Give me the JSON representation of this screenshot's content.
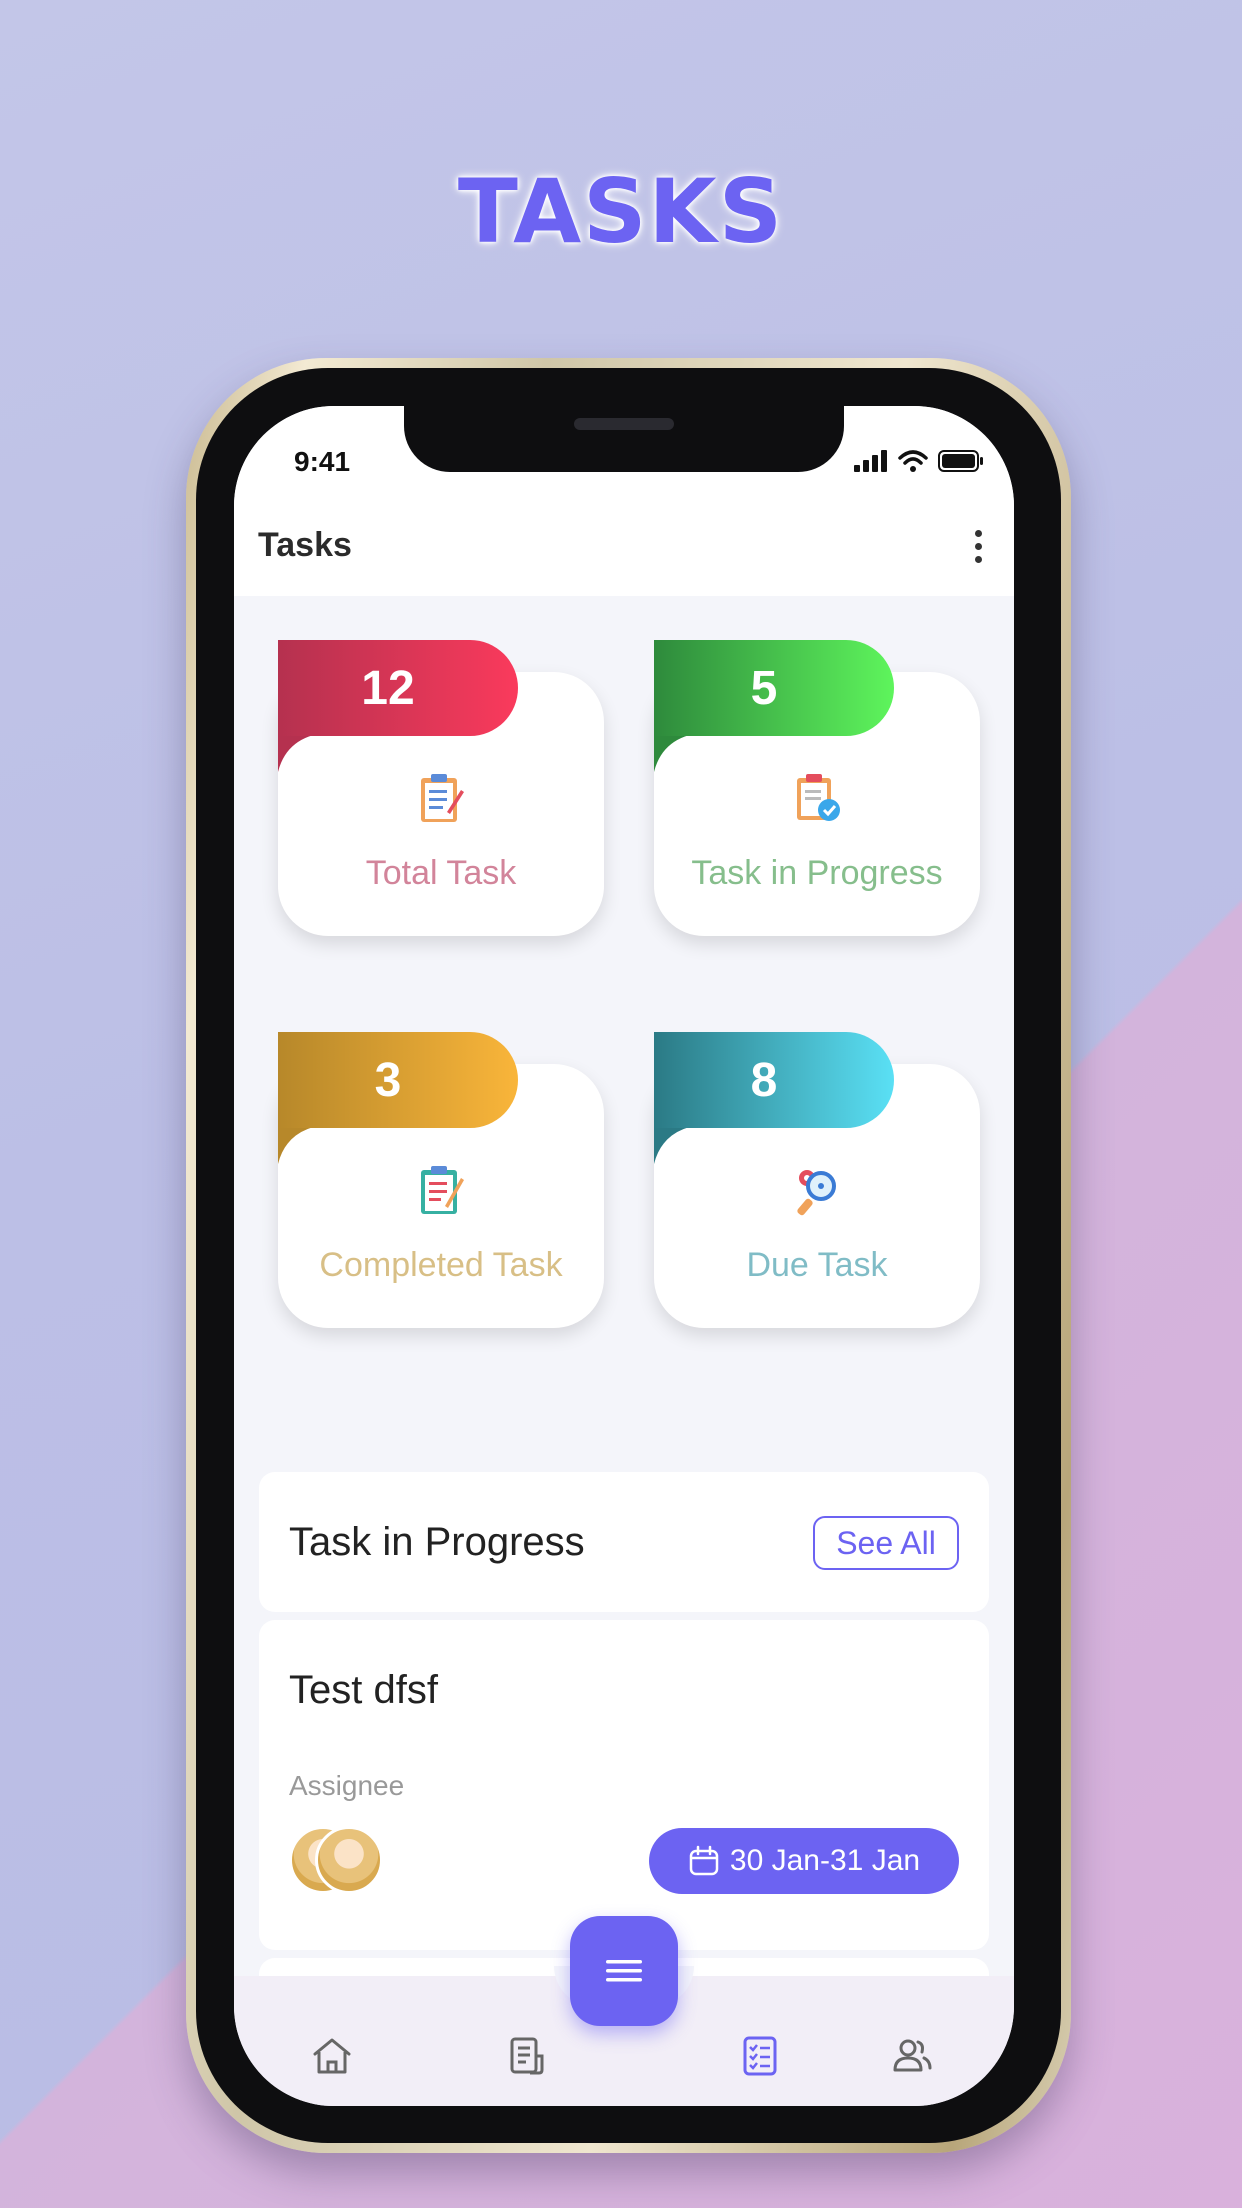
{
  "promo": {
    "title": "TASKS"
  },
  "status_bar": {
    "time": "9:41"
  },
  "app_bar": {
    "title": "Tasks"
  },
  "stats": [
    {
      "count": "12",
      "label": "Total Task",
      "color_from": "#b5314f",
      "color_to": "#fa3a5c",
      "label_color": "#d2849a",
      "icon": "clipboard-checklist-icon"
    },
    {
      "count": "5",
      "label": "Task in Progress",
      "color_from": "#2e8a3c",
      "color_to": "#5ef55c",
      "label_color": "#86be8c",
      "icon": "clipboard-progress-icon"
    },
    {
      "count": "3",
      "label": "Completed Task",
      "color_from": "#b7882a",
      "color_to": "#f9b53a",
      "label_color": "#d8bf86",
      "icon": "clipboard-completed-icon"
    },
    {
      "count": "8",
      "label": "Due Task",
      "color_from": "#2b7a85",
      "color_to": "#5ae0f5",
      "label_color": "#80bcc6",
      "icon": "search-gear-icon"
    }
  ],
  "progress_section": {
    "title": "Task in Progress",
    "see_all": "See All",
    "task": {
      "title": "Test dfsf",
      "assignee_label": "Assignee",
      "date_range": "30 Jan-31 Jan"
    }
  },
  "bottom_nav": {
    "items": [
      "home-icon",
      "document-icon",
      "tasks-icon",
      "users-icon"
    ],
    "active": "tasks-icon",
    "accent": "#6c63f2"
  }
}
